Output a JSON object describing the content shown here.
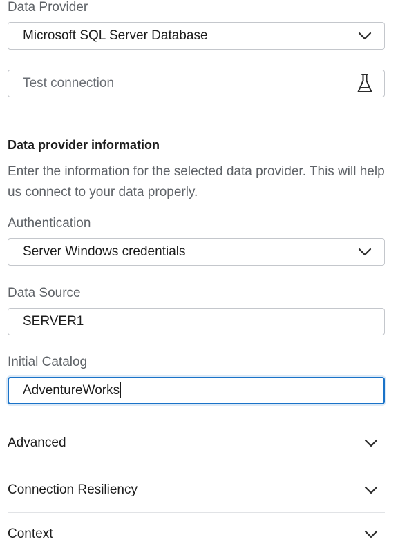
{
  "data_provider": {
    "label": "Data Provider",
    "value": "Microsoft SQL Server Database"
  },
  "test_connection": {
    "placeholder": "Test connection"
  },
  "provider_info": {
    "heading": "Data provider information",
    "description": "Enter the information for the selected data provider. This will help us connect to your data properly."
  },
  "authentication": {
    "label": "Authentication",
    "value": "Server Windows credentials"
  },
  "data_source": {
    "label": "Data Source",
    "value": "SERVER1"
  },
  "initial_catalog": {
    "label": "Initial Catalog",
    "value": "AdventureWorks"
  },
  "sections": [
    {
      "title": "Advanced"
    },
    {
      "title": "Connection Resiliency"
    },
    {
      "title": "Context"
    }
  ],
  "icons": {
    "dropdown": "chevron-down-icon",
    "test": "flask-icon"
  },
  "colors": {
    "focus_border": "#1a73c8",
    "border": "#c4c7cc",
    "divider": "#e1e3e6"
  }
}
